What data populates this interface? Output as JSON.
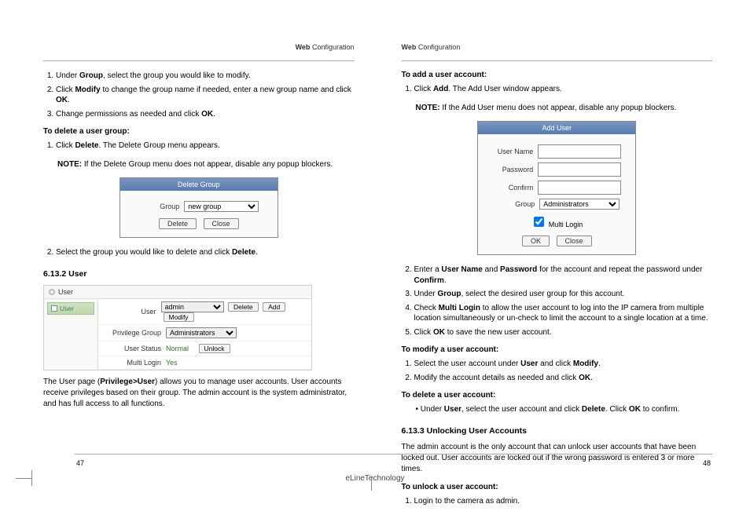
{
  "header": {
    "web_label": "Web",
    "config_label": "Configuration"
  },
  "left": {
    "intro_list": [
      {
        "prefix": "Under ",
        "b1": "Group",
        "after1": ", select the group you would like to modify."
      },
      {
        "prefix": "Click ",
        "b1": "Modify",
        "after1": " to change the group name if needed, enter a new group name and click ",
        "b2": "OK",
        "after2": "."
      },
      {
        "prefix": "Change permissions as needed and click ",
        "b1": "OK",
        "after1": "."
      }
    ],
    "delete_title": "To delete a user group:",
    "delete_list": [
      {
        "prefix": "Click ",
        "b1": "Delete",
        "after1": ". The Delete Group menu appears."
      }
    ],
    "note_label": "NOTE:",
    "note_text": " If the Delete Group menu does not appear, disable any popup blockers.",
    "dlg_delete": {
      "title": "Delete Group",
      "group_label": "Group",
      "group_value": "new group",
      "btn_delete": "Delete",
      "btn_close": "Close"
    },
    "delete_list2": [
      {
        "prefix": "Select the group you would like to delete and click ",
        "b1": "Delete",
        "after1": "."
      }
    ],
    "user_heading": "6.13.2 User",
    "user_fig": {
      "sidebar_label": "User",
      "sidebar_tab": "User",
      "row_user": "User",
      "user_sel": "admin",
      "btn_delete": "Delete",
      "btn_add": "Add",
      "btn_modify": "Modify",
      "row_privgroup": "Privilege Group",
      "privgroup_sel": "Administrators",
      "row_status": "User Status",
      "status_val": "Normal",
      "btn_unlock": "Unlock",
      "row_multi": "Multi Login",
      "multi_val": "Yes"
    },
    "user_para_a": "The User page (",
    "user_para_bold": "Privilege>User",
    "user_para_b": ") allows you to manage user accounts. User accounts receive privileges based on their group. The admin account is the system administrator, and has full access to all functions."
  },
  "right": {
    "add_title": "To add a user account:",
    "add_list1": [
      {
        "prefix": "Click ",
        "b1": "Add",
        "after1": ". The Add User window appears."
      }
    ],
    "note_label": "NOTE:",
    "note_text": " If the Add User menu does not appear, disable any popup blockers.",
    "dlg_add": {
      "title": "Add User",
      "username_label": "User Name",
      "password_label": "Password",
      "confirm_label": "Confirm",
      "group_label": "Group",
      "group_value": "Administrators",
      "multi_label": "Multi Login",
      "btn_ok": "OK",
      "btn_close": "Close"
    },
    "add_list2": [
      {
        "prefix": "Enter a ",
        "b1": "User Name",
        "after1": " and ",
        "b2": "Password",
        "after2": " for the account and repeat the password under ",
        "b3": "Confirm",
        "after3": "."
      },
      {
        "prefix": "Under ",
        "b1": "Group",
        "after1": ", select the desired user group for this account."
      },
      {
        "prefix": "Check ",
        "b1": "Multi Login",
        "after1": " to allow the user account to log into the IP camera from multiple location simultaneously or un-check to limit the account to a single location at a time."
      },
      {
        "prefix": "Click ",
        "b1": "OK",
        "after1": " to save the new user account."
      }
    ],
    "modify_title": "To modify a user account:",
    "modify_list": [
      {
        "prefix": "Select the user account under ",
        "b1": "User",
        "after1": " and click ",
        "b2": "Modify",
        "after2": "."
      },
      {
        "prefix": "Modify the account details as needed and click ",
        "b1": "OK",
        "after1": "."
      }
    ],
    "deleteacct_title": "To delete a user account:",
    "deleteacct_bullet_a": "Under ",
    "deleteacct_bullet_b1": "User",
    "deleteacct_bullet_mid": ", select the user account and click ",
    "deleteacct_bullet_b2": "Delete",
    "deleteacct_bullet_mid2": ". Click ",
    "deleteacct_bullet_b3": "OK",
    "deleteacct_bullet_end": " to confirm.",
    "unlock_heading": "6.13.3 Unlocking User Accounts",
    "unlock_para": "The admin account is the only account that can unlock user accounts that have been locked out. User accounts are locked out if the wrong password is entered 3 or more times.",
    "unlock_title": "To unlock a user account:",
    "unlock_list": [
      {
        "prefix": "Login to the camera as admin."
      }
    ]
  },
  "footer": {
    "page_left": "47",
    "page_right": "48",
    "brand": "eLineTechnology"
  }
}
